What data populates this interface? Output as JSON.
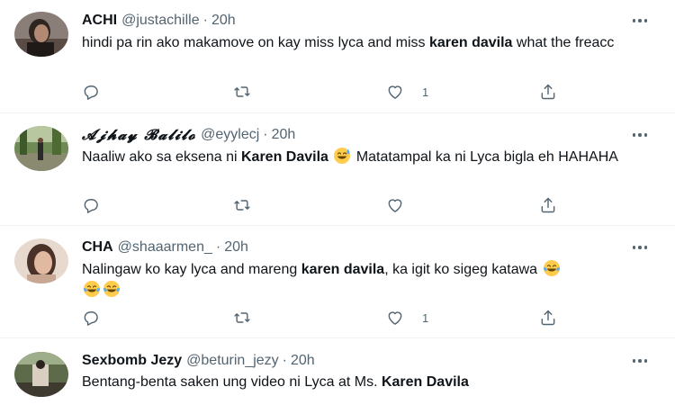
{
  "tweets": [
    {
      "name": "ACHI",
      "handle": "@justachille",
      "time": "20h",
      "text_parts": [
        "hindi pa rin ako makamove on kay miss lyca and miss ",
        "karen davila",
        " what the freacc"
      ],
      "reply_count": "",
      "retweet_count": "",
      "like_count": "1"
    },
    {
      "name": "𝓐𝓳𝓱𝓪𝔂 𝓑𝓪𝓵𝓲𝓵𝓸",
      "handle": "@eyylecj",
      "time": "20h",
      "text_parts": [
        "Naaliw ako sa eksena ni ",
        "Karen Davila",
        " ",
        " Matatampal ka ni Lyca bigla eh HAHAHA"
      ],
      "reply_count": "",
      "retweet_count": "",
      "like_count": ""
    },
    {
      "name": "CHA",
      "handle": "@shaaarmen_",
      "time": "20h",
      "text_parts": [
        "Nalingaw ko kay lyca and mareng ",
        "karen davila",
        ", ka igit ko sigeg katawa "
      ],
      "reply_count": "",
      "retweet_count": "",
      "like_count": "1"
    },
    {
      "name": "Sexbomb Jezy",
      "handle": "@beturin_jezy",
      "time": "20h",
      "text_parts": [
        "Bentang-benta saken ung video ni Lyca at Ms. ",
        "Karen Davila"
      ]
    }
  ],
  "icons": {
    "reply": "reply-icon",
    "retweet": "retweet-icon",
    "like": "heart-icon",
    "share": "share-icon",
    "more": "more-icon",
    "emoji_sweat": "grinning-sweat-emoji",
    "emoji_tears": "tears-of-joy-emoji"
  },
  "colors": {
    "text": "#0f1419",
    "secondary": "#536471",
    "divider": "#eff3f4",
    "emoji": "#ffcc4d"
  }
}
